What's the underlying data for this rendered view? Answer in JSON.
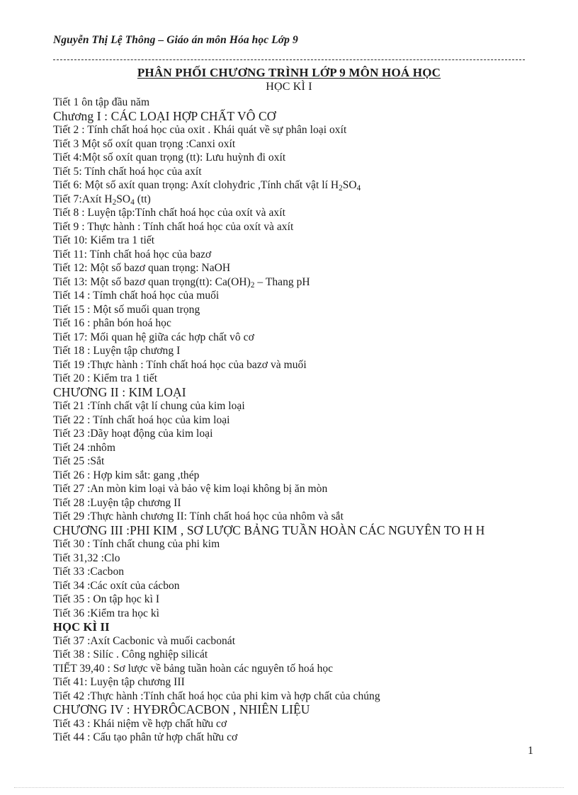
{
  "document": {
    "running_header": "Nguyễn Thị Lệ Thông – Giáo án môn Hóa học Lớp 9",
    "main_title": "PHÂN PHỐI CHƯƠNG TRÌNH LỚP 9 MÔN HOÁ HỌC",
    "sub_title": "HỌC KÌ I",
    "page_number": "1"
  },
  "lines": [
    {
      "text": "Tiết  1 ôn tập đầu năm",
      "style": "normal"
    },
    {
      "text": "Chương  I : CÁC LOẠI HỢP CHẤT VÔ CƠ",
      "style": "chapter"
    },
    {
      "text": "Tiết  2 : Tính  chất hoá học của oxit . Khái quát về sự phân loại  oxít",
      "style": "normal"
    },
    {
      "text": "Tiết  3 Một số oxít  quan trọng :Canxi  oxít",
      "style": "normal"
    },
    {
      "text": "Tiết  4:Một số oxít  quan trọng (tt): Lưu huỳnh  đi oxít",
      "style": "normal"
    },
    {
      "text": "Tiết  5: Tính  chất hoá học của axít",
      "style": "normal"
    },
    {
      "text": "Tiết  6: Một số axít  quan trọng:  Axít  clohyđric  ,Tính  chất vật lí H2SO4",
      "style": "normal",
      "subs": [
        [
          "H2SO4",
          "H",
          "2",
          "SO",
          "4"
        ]
      ]
    },
    {
      "text": "Tiết  7:Axít  H2SO4 (tt)",
      "style": "normal"
    },
    {
      "text": "Tiết  8 : Luyện  tập:Tính  chất hoá học của oxít và axít",
      "style": "normal"
    },
    {
      "text": "Tiết  9 : Thực  hành : Tính  chất hoá học của oxít  và axít",
      "style": "normal"
    },
    {
      "text": "Tiết  10: Kiểm  tra 1 tiết",
      "style": "normal"
    },
    {
      "text": "Tiết  11: Tính  chất hoá học của bazơ",
      "style": "normal"
    },
    {
      "text": "Tiết  12: Một số bazơ  quan trọng:  NaOH",
      "style": "normal"
    },
    {
      "text": "Tiết  13: Một số bazơ  quan trọng(tt):  Ca(OH)2 – Thang  pH",
      "style": "normal"
    },
    {
      "text": "Tiết  14 : Tímh  chất hoá học của muối",
      "style": "normal"
    },
    {
      "text": "Tiết  15 : Một số muối  quan trọng",
      "style": "normal"
    },
    {
      "text": "Tiết  16 : phân bón hoá học",
      "style": "normal"
    },
    {
      "text": "Tiết  17: Mối quan hệ giữa các hợp chất vô cơ",
      "style": "normal"
    },
    {
      "text": "Tiết  18 : Luyện  tập chương  I",
      "style": "normal"
    },
    {
      "text": "Tiết  19 :Thực  hành : Tính  chất hoá học của bazơ và muối",
      "style": "normal"
    },
    {
      "text": "Tiết  20 : Kiểm  tra 1 tiết",
      "style": "normal"
    },
    {
      "text": "CHƯƠNG II : KIM LOẠI",
      "style": "chapter"
    },
    {
      "text": "Tiết  21 :Tính  chất vật lí chung  của kim  loại",
      "style": "normal"
    },
    {
      "text": "Tiết  22 : Tính  chất hoá học của kim  loại",
      "style": "normal"
    },
    {
      "text": "Tiết  23 :Dãy  hoạt động của kim  loại",
      "style": "normal"
    },
    {
      "text": "Tiết  24 :nhôm",
      "style": "normal"
    },
    {
      "text": "Tiết  25 :Sắt",
      "style": "normal"
    },
    {
      "text": "Tiết  26 : Hợp kim  sắt: gang  ,thép",
      "style": "normal"
    },
    {
      "text": "Tiết  27 :An mòn kim  loại và bảo vệ kim  loại không bị ăn mòn",
      "style": "normal"
    },
    {
      "text": "Tiết  28 :Luyện   tập chương  II",
      "style": "normal"
    },
    {
      "text": "Tiết  29 :Thực  hành chương  II: Tính  chất hoá học của nhôm  và sắt",
      "style": "normal"
    },
    {
      "text": "CHƯƠNG III :PHI KIM , SƠ LƯỢC BẢNG TUẦN HOÀN CÁC NGUYÊN TO H H",
      "style": "chapter"
    },
    {
      "text": "Tiết  30 : Tính  chất chung  của phi kim",
      "style": "normal"
    },
    {
      "text": "Tiết  31,32 :Clo",
      "style": "normal"
    },
    {
      "text": "Tiết  33 :Cacbon",
      "style": "normal"
    },
    {
      "text": "Tiết  34 :Các oxít của cácbon",
      "style": "normal"
    },
    {
      "text": "Tiết  35 : On tập học kì I",
      "style": "normal"
    },
    {
      "text": "Tiết  36 :Kiểm  tra học kì",
      "style": "normal"
    },
    {
      "text": "HỌC KÌ II",
      "style": "term-heading"
    },
    {
      "text": "Tiết  37 :Axít  Cacbonic  và muối  cacbonát",
      "style": "normal"
    },
    {
      "text": "Tiết  38 : Silíc  . Công nghiệp  silicát",
      "style": "normal"
    },
    {
      "text": "TIẾT  39,40 : Sơ lược về bảng tuần  hoàn các nguyên  tố hoá học",
      "style": "normal"
    },
    {
      "text": "Tiết  41: Luyện  tập chương  III",
      "style": "normal"
    },
    {
      "text": "Tiết  42 :Thực  hành :Tính  chất hoá học của phi kim  và hợp chất của chúng",
      "style": "normal"
    },
    {
      "text": "CHƯƠNG IV : HYĐRÔCACBON , NHIÊN LIỆU",
      "style": "chapter"
    },
    {
      "text": "Tiết  43 : Khái niệm  về hợp chất hữu cơ",
      "style": "normal"
    },
    {
      "text": "Tiết  44 : Cấu tạo phân tử hợp chất hữu cơ",
      "style": "normal"
    }
  ]
}
